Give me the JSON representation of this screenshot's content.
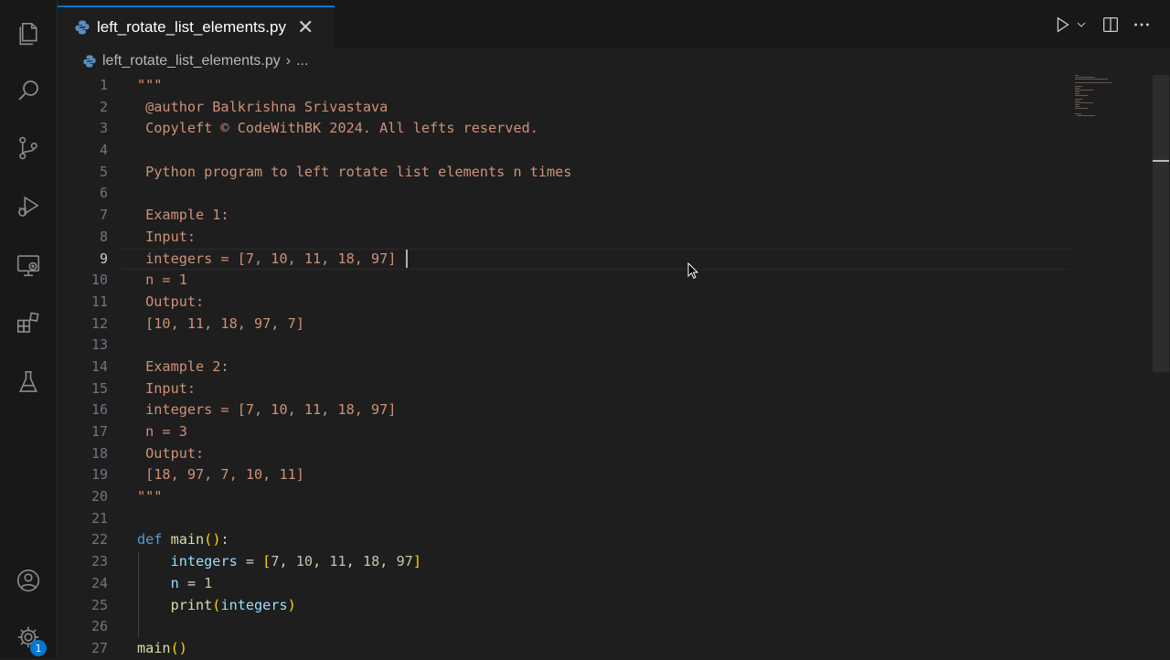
{
  "tab": {
    "filename": "left_rotate_list_elements.py",
    "close_glyph": "✕"
  },
  "breadcrumb": {
    "file": "left_rotate_list_elements.py",
    "separator": "›",
    "more": "..."
  },
  "activity_bar": {
    "items": [
      "explorer-icon",
      "search-icon",
      "source-control-icon",
      "run-debug-icon",
      "remote-explorer-icon",
      "extensions-icon",
      "testing-icon"
    ],
    "bottom": [
      "accounts-icon",
      "manage-gear-icon"
    ],
    "badge": "1"
  },
  "editor": {
    "active_line": 9,
    "line_numbers": [
      "1",
      "2",
      "3",
      "4",
      "5",
      "6",
      "7",
      "8",
      "9",
      "10",
      "11",
      "12",
      "13",
      "14",
      "15",
      "16",
      "17",
      "18",
      "19",
      "20",
      "21",
      "22",
      "23",
      "24",
      "25",
      "26",
      "27"
    ],
    "docstring": {
      "open": "\"\"\"",
      "l2": " @author Balkrishna Srivastava",
      "l3": " Copyleft © CodeWithBK 2024. All lefts reserved.",
      "l5": " Python program to left rotate list elements n times",
      "l7": " Example 1:",
      "l8": " Input:",
      "l9": " integers = [7, 10, 11, 18, 97]",
      "l10": " n = 1",
      "l11": " Output:",
      "l12": " [10, 11, 18, 97, 7]",
      "l14": " Example 2:",
      "l15": " Input:",
      "l16": " integers = [7, 10, 11, 18, 97]",
      "l17": " n = 3",
      "l18": " Output:",
      "l19": " [18, 97, 7, 10, 11]",
      "close": "\"\"\""
    },
    "code": {
      "def_kw": "def",
      "main_name": "main",
      "var_integers": "integers",
      "var_n": "n",
      "eq": " = ",
      "nums": [
        "7",
        "10",
        "11",
        "18",
        "97"
      ],
      "comma": ", ",
      "n_val": "1",
      "print_fn": "print",
      "colon": ":"
    }
  },
  "colors": {
    "accent": "#0078d4",
    "string": "#ce9178",
    "keyword": "#569cd6",
    "function": "#dcdcaa",
    "variable": "#9cdcfe",
    "number": "#b5cea8"
  }
}
